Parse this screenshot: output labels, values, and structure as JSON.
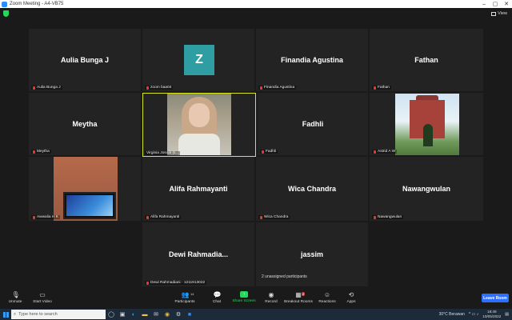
{
  "window": {
    "title": "Zoom Meeting - A4-VB75"
  },
  "topbar": {
    "view_label": "View"
  },
  "participants": [
    {
      "id": "aulia",
      "display": "Aulia Bunga J",
      "label": "Aulia Bunga J"
    },
    {
      "id": "zoom",
      "display": "Z",
      "label": "zoom baa04"
    },
    {
      "id": "finandia",
      "display": "Finandia Agustina",
      "label": "Finandia Agustina"
    },
    {
      "id": "fathan",
      "display": "Fathan",
      "label": "Fathan"
    },
    {
      "id": "meytha",
      "display": "Meytha",
      "label": "Meytha"
    },
    {
      "id": "virginia",
      "display": "",
      "label": "Virginia Josodi (ti..."
    },
    {
      "id": "fadhli",
      "display": "Fadhli",
      "label": "Fadhli"
    },
    {
      "id": "astrid",
      "display": "",
      "label": "Astrid A W"
    },
    {
      "id": "awwalia",
      "display": "",
      "label": "Awwalia H K"
    },
    {
      "id": "alifa",
      "display": "Alifa Rahmayanti",
      "label": "Alifa Rahmayanti"
    },
    {
      "id": "wica",
      "display": "Wica Chandra",
      "label": "Wica Chandra"
    },
    {
      "id": "nawang",
      "display": "Nawangwulan",
      "label": "Nawangwulan"
    },
    {
      "id": "dewi",
      "display": "Dewi  Rahmadia...",
      "label": "Dewi Rahmadiani - 1211913022"
    },
    {
      "id": "jassim",
      "display": "jassim",
      "label": ""
    }
  ],
  "unassigned": "2 unassigned participants",
  "toolbar": {
    "unmute": "Unmute",
    "start_video": "Start Video",
    "participants": "Participants",
    "participants_count": "14",
    "chat": "Chat",
    "share": "Share Screen",
    "record": "Record",
    "breakout": "Breakout Rooms",
    "breakout_badge": "2",
    "reactions": "Reactions",
    "apps": "Apps",
    "leave": "Leave Room"
  },
  "taskbar": {
    "search_placeholder": "Type here to search",
    "weather": "30°C  Berawan",
    "time": "18:49",
    "date": "10/05/2022"
  },
  "icons": [
    "zoom-logo-icon",
    "shield-icon",
    "view-grid-icon",
    "mic-muted-icon",
    "video-off-icon",
    "participants-icon",
    "chat-icon",
    "share-screen-icon",
    "record-icon",
    "breakout-rooms-icon",
    "reactions-icon",
    "apps-icon",
    "windows-start-icon",
    "search-icon"
  ]
}
